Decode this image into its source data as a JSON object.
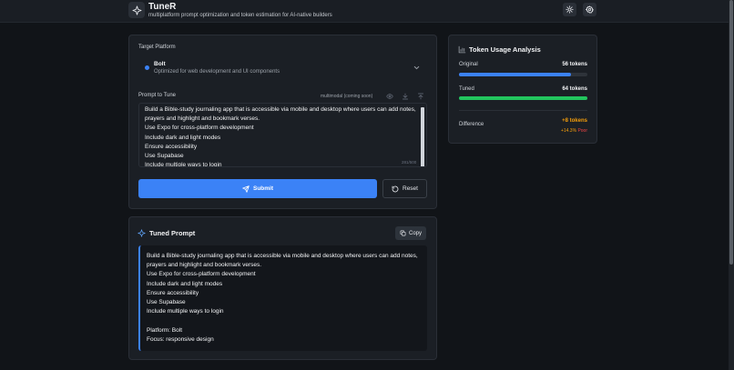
{
  "header": {
    "title": "TuneR",
    "subtitle": "multiplatform prompt optimization and token estimation for AI-native builders",
    "logo_icon": "sparkle-icon",
    "theme_icon": "sun-icon",
    "settings_icon": "gear-icon"
  },
  "platform": {
    "label": "Target Platform",
    "selected_name": "Bolt",
    "selected_desc": "Optimized for web development and UI components",
    "accent": "#3b82f6"
  },
  "prompt": {
    "label": "Prompt to Tune",
    "multimodal_note": "multimodal (coming soon)",
    "text": "Build a Bible-study journaling app that is accessible via mobile and desktop where users can add notes, prayers and highlight and bookmark verses.\nUse Expo for cross-platform development\nInclude dark and light modes\nEnsure accessibility\nUse Supabase\nInclude multiple ways to login",
    "char_count": "281/500"
  },
  "actions": {
    "submit_label": "Submit",
    "reset_label": "Reset"
  },
  "tuned": {
    "title": "Tuned Prompt",
    "copy_label": "Copy",
    "text": "Build a Bible-study journaling app that is accessible via mobile and desktop where users can add notes, prayers and highlight and bookmark verses.\nUse Expo for cross-platform development\nInclude dark and light modes\nEnsure accessibility\nUse Supabase\nInclude multiple ways to login\n\nPlatform: Bolt\nFocus: responsive design"
  },
  "tokens": {
    "title": "Token Usage Analysis",
    "original_label": "Original",
    "original_value": "56 tokens",
    "original_fraction": 0.875,
    "tuned_label": "Tuned",
    "tuned_value": "64 tokens",
    "tuned_fraction": 1.0,
    "difference_label": "Difference",
    "difference_value": "+8 tokens",
    "difference_pct": "+14.3%",
    "difference_rating": "Poor",
    "original_color": "#3b82f6",
    "tuned_color": "#22c55e",
    "diff_color": "#f59e0b",
    "rating_color": "#ef4444"
  }
}
